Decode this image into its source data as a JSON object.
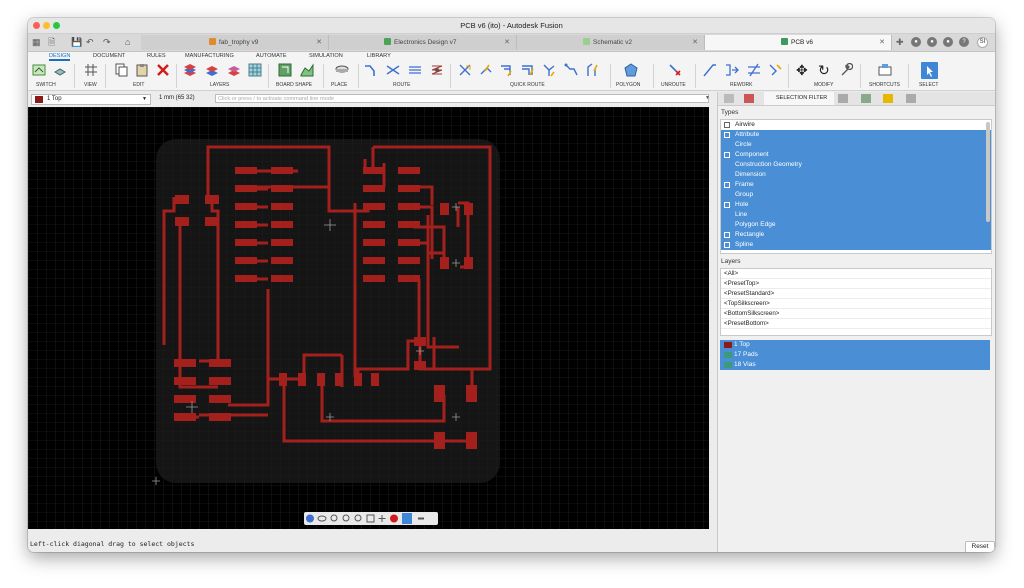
{
  "window": {
    "title": "PCB v6 (ito) - Autodesk Fusion"
  },
  "tabs": [
    {
      "label": "fab_trophy v9",
      "icon": "pcb-trophy-icon"
    },
    {
      "label": "Electronics Design v7",
      "icon": "electronics-design-icon"
    },
    {
      "label": "Schematic v2",
      "icon": "schematic-icon"
    },
    {
      "label": "PCB v6",
      "icon": "pcb-icon",
      "active": true
    }
  ],
  "user_initials": "SI",
  "mode_tabs": [
    "DESIGN",
    "DOCUMENT",
    "RULES",
    "MANUFACTURING",
    "AUTOMATE",
    "SIMULATION",
    "LIBRARY"
  ],
  "ribbon_groups": [
    "SWITCH",
    "VIEW",
    "EDIT",
    "LAYERS",
    "BOARD SHAPE",
    "PLACE",
    "ROUTE",
    "QUICK ROUTE",
    "POLYGON",
    "UNROUTE",
    "REWORK",
    "MODIFY",
    "SHORTCUTS",
    "SELECT"
  ],
  "command_bar": {
    "layer": "1 Top",
    "grid": "1 mm (65 32)",
    "placeholder": "Click or press / to activate command line mode"
  },
  "status": {
    "message": "Left-click diagonal drag to select objects"
  },
  "selection_filter": {
    "tab_label": "SELECTION FILTER",
    "types_title": "Types",
    "types": [
      {
        "label": "Airwire",
        "selected": false,
        "icon": "airwire-icon"
      },
      {
        "label": "Attribute",
        "selected": true,
        "icon": "attribute-icon"
      },
      {
        "label": "Circle",
        "selected": true,
        "icon": ""
      },
      {
        "label": "Component",
        "selected": true,
        "icon": "component-icon"
      },
      {
        "label": "Construction Geometry",
        "selected": true,
        "icon": ""
      },
      {
        "label": "Dimension",
        "selected": true,
        "icon": ""
      },
      {
        "label": "Frame",
        "selected": true,
        "icon": "frame-icon"
      },
      {
        "label": "Group",
        "selected": true,
        "icon": ""
      },
      {
        "label": "Hole",
        "selected": true,
        "icon": "hole-icon"
      },
      {
        "label": "Line",
        "selected": true,
        "icon": ""
      },
      {
        "label": "Polygon Edge",
        "selected": true,
        "icon": ""
      },
      {
        "label": "Rectangle",
        "selected": true,
        "icon": "rectangle-icon"
      },
      {
        "label": "Spline",
        "selected": true,
        "icon": "spline-icon"
      }
    ],
    "layers_title": "Layers",
    "layer_presets": [
      "<All>",
      "<PresetTop>",
      "<PresetStandard>",
      "<TopSilkscreen>",
      "<BottomSilkscreen>",
      "<PresetBottom>"
    ],
    "layers": [
      {
        "label": "1 Top",
        "color": "#8b1a1a"
      },
      {
        "label": "17 Pads",
        "color": "#3a9a7a"
      },
      {
        "label": "18 Vias",
        "color": "#3a9a7a"
      }
    ],
    "reset_label": "Reset"
  },
  "colors": {
    "trace": "#a3201c",
    "board": "#151515",
    "grid": "#2c2c2c",
    "selection": "#4a8fd6"
  }
}
